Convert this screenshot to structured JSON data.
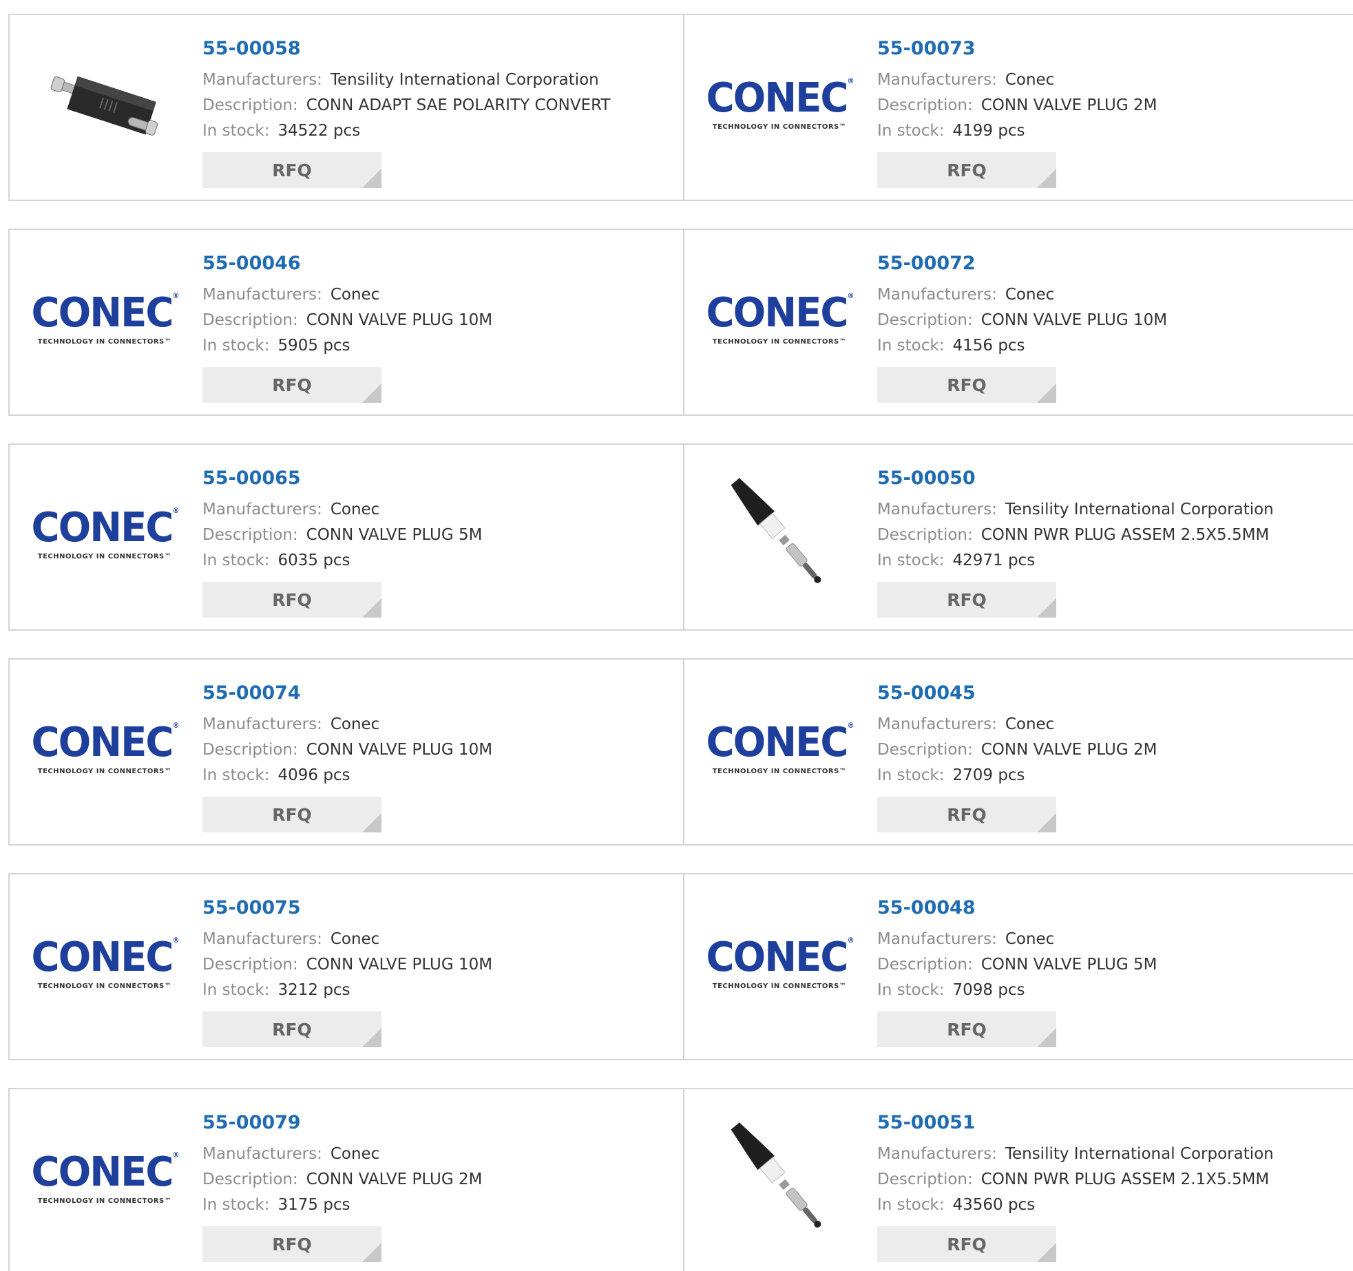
{
  "labels": {
    "manufacturers": "Manufacturers:",
    "description": "Description:",
    "in_stock": "In stock:",
    "rfq": "RFQ"
  },
  "logo": {
    "word": "CONEC",
    "tagline": "TECHNOLOGY IN CONNECTORS™"
  },
  "products": [
    {
      "part": "55-00058",
      "manufacturer": "Tensility International Corporation",
      "description": "CONN ADAPT SAE POLARITY CONVERT",
      "stock": "34522 pcs",
      "image": "sae-adapter"
    },
    {
      "part": "55-00073",
      "manufacturer": "Conec",
      "description": "CONN VALVE PLUG 2M",
      "stock": "4199 pcs",
      "image": "conec-logo"
    },
    {
      "part": "55-00046",
      "manufacturer": "Conec",
      "description": "CONN VALVE PLUG 10M",
      "stock": "5905 pcs",
      "image": "conec-logo"
    },
    {
      "part": "55-00072",
      "manufacturer": "Conec",
      "description": "CONN VALVE PLUG 10M",
      "stock": "4156 pcs",
      "image": "conec-logo"
    },
    {
      "part": "55-00065",
      "manufacturer": "Conec",
      "description": "CONN VALVE PLUG 5M",
      "stock": "6035 pcs",
      "image": "conec-logo"
    },
    {
      "part": "55-00050",
      "manufacturer": "Tensility International Corporation",
      "description": "CONN PWR PLUG ASSEM 2.5X5.5MM",
      "stock": "42971 pcs",
      "image": "power-plug"
    },
    {
      "part": "55-00074",
      "manufacturer": "Conec",
      "description": "CONN VALVE PLUG 10M",
      "stock": "4096 pcs",
      "image": "conec-logo"
    },
    {
      "part": "55-00045",
      "manufacturer": "Conec",
      "description": "CONN VALVE PLUG 2M",
      "stock": "2709 pcs",
      "image": "conec-logo"
    },
    {
      "part": "55-00075",
      "manufacturer": "Conec",
      "description": "CONN VALVE PLUG 10M",
      "stock": "3212 pcs",
      "image": "conec-logo"
    },
    {
      "part": "55-00048",
      "manufacturer": "Conec",
      "description": "CONN VALVE PLUG 5M",
      "stock": "7098 pcs",
      "image": "conec-logo"
    },
    {
      "part": "55-00079",
      "manufacturer": "Conec",
      "description": "CONN VALVE PLUG 2M",
      "stock": "3175 pcs",
      "image": "conec-logo"
    },
    {
      "part": "55-00051",
      "manufacturer": "Tensility International Corporation",
      "description": "CONN PWR PLUG ASSEM 2.1X5.5MM",
      "stock": "43560 pcs",
      "image": "power-plug"
    }
  ],
  "colors": {
    "part_link": "#1f6cb3",
    "label": "#8c8c8c",
    "value": "#333333",
    "border": "#d4d4d4",
    "rfq_bg": "#ececec",
    "logo_blue": "#1e3f9b"
  }
}
